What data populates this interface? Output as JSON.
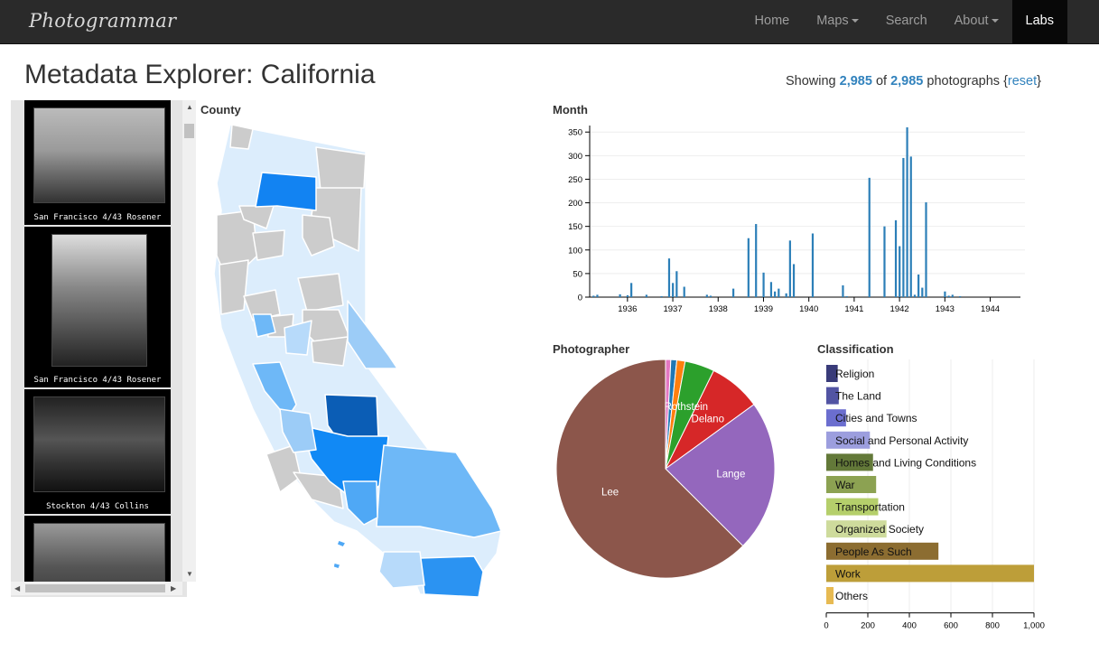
{
  "navbar": {
    "brand": "Photogrammar",
    "items": [
      {
        "label": "Home",
        "dropdown": false,
        "active": false
      },
      {
        "label": "Maps",
        "dropdown": true,
        "active": false
      },
      {
        "label": "Search",
        "dropdown": false,
        "active": false
      },
      {
        "label": "About",
        "dropdown": true,
        "active": false
      },
      {
        "label": "Labs",
        "dropdown": false,
        "active": true
      }
    ]
  },
  "page": {
    "title": "Metadata Explorer: California"
  },
  "counter": {
    "prefix": "Showing",
    "shown": "2,985",
    "of": "of",
    "total": "2,985",
    "suffix": "photographs",
    "brace_open": "{",
    "reset": "reset",
    "brace_close": "}"
  },
  "thumbnails": [
    {
      "caption": "San Francisco 4/43 Rosener"
    },
    {
      "caption": "San Francisco 4/43 Rosener"
    },
    {
      "caption": "Stockton 4/43 Collins"
    },
    {
      "caption": ""
    }
  ],
  "county_map": {
    "label": "County"
  },
  "chart_data": [
    {
      "type": "bar",
      "title": "Month",
      "ylim": [
        0,
        360
      ],
      "yticks": [
        0,
        50,
        100,
        150,
        200,
        250,
        300,
        350
      ],
      "xticks": [
        "1936",
        "1937",
        "1938",
        "1939",
        "1940",
        "1941",
        "1942",
        "1943",
        "1944"
      ],
      "xrange": [
        "1935-03",
        "1944-09"
      ],
      "x": [
        "1935-04",
        "1935-05",
        "1935-11",
        "1936-01",
        "1936-02",
        "1936-06",
        "1936-10",
        "1936-12",
        "1937-01",
        "1937-02",
        "1937-04",
        "1937-10",
        "1937-11",
        "1938-05",
        "1938-09",
        "1938-11",
        "1939-01",
        "1939-03",
        "1939-04",
        "1939-05",
        "1939-07",
        "1939-08",
        "1939-09",
        "1940-02",
        "1940-10",
        "1940-11",
        "1941-05",
        "1941-09",
        "1941-12",
        "1942-01",
        "1942-02",
        "1942-03",
        "1942-04",
        "1942-05",
        "1942-06",
        "1942-07",
        "1942-08",
        "1943-01",
        "1943-02",
        "1943-03",
        "1943-05"
      ],
      "values": [
        3,
        5,
        6,
        4,
        30,
        5,
        2,
        82,
        30,
        55,
        22,
        5,
        3,
        18,
        125,
        155,
        52,
        32,
        12,
        18,
        8,
        120,
        70,
        135,
        25,
        2,
        253,
        150,
        163,
        108,
        295,
        360,
        298,
        5,
        48,
        20,
        201,
        12,
        3,
        5,
        2
      ],
      "color": "#2c7fb8"
    },
    {
      "type": "pie",
      "title": "Photographer",
      "labels": [
        "Lee",
        "Lange",
        "Delano",
        "Rothstein",
        "",
        "",
        " "
      ],
      "slice_names": [
        "Lee",
        "Lange",
        "Delano",
        "Rothstein",
        "unlabeled-1",
        "unlabeled-2",
        "unlabeled-3"
      ],
      "values": [
        1780,
        640,
        220,
        125,
        35,
        25,
        22
      ],
      "colors": [
        "#8c564b",
        "#9467bd",
        "#d62728",
        "#2ca02c",
        "#ff7f0e",
        "#1f77b4",
        "#e377c2"
      ]
    },
    {
      "type": "bar",
      "orientation": "horizontal",
      "title": "Classification",
      "categories": [
        "Religion",
        "The Land",
        "Cities and Towns",
        "Social and Personal Activity",
        "Homes and Living Conditions",
        "War",
        "Transportation",
        "Organized Society",
        "People As Such",
        "Work",
        "Others"
      ],
      "values": [
        55,
        60,
        95,
        210,
        225,
        240,
        250,
        290,
        540,
        1000,
        35
      ],
      "colors": [
        "#393b79",
        "#5254a3",
        "#6b6ecf",
        "#9c9ede",
        "#637939",
        "#8ca252",
        "#b5cf6b",
        "#cedb9c",
        "#8c6d31",
        "#bd9e39",
        "#e7ba52"
      ],
      "xlim": [
        0,
        1000
      ],
      "xticks": [
        "0",
        "200",
        "400",
        "600",
        "800",
        "1,000"
      ]
    }
  ]
}
